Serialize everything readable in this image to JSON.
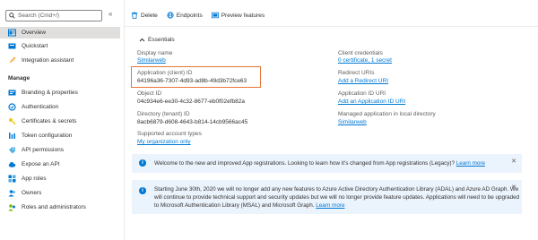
{
  "sidebar": {
    "search_placeholder": "Search (Cmd+/)",
    "collapse_glyph": "«",
    "top_items": [
      {
        "label": "Overview",
        "icon": "overview-icon"
      },
      {
        "label": "Quickstart",
        "icon": "quickstart-icon"
      },
      {
        "label": "Integration assistant",
        "icon": "rocket-icon"
      }
    ],
    "section_manage": "Manage",
    "manage_items": [
      {
        "label": "Branding & properties",
        "icon": "branding-icon"
      },
      {
        "label": "Authentication",
        "icon": "authentication-icon"
      },
      {
        "label": "Certificates & secrets",
        "icon": "key-icon"
      },
      {
        "label": "Token configuration",
        "icon": "token-icon"
      },
      {
        "label": "API permissions",
        "icon": "api-permissions-icon"
      },
      {
        "label": "Expose an API",
        "icon": "cloud-icon"
      },
      {
        "label": "App roles",
        "icon": "app-roles-icon"
      },
      {
        "label": "Owners",
        "icon": "owners-icon"
      },
      {
        "label": "Roles and administrators",
        "icon": "roles-icon"
      }
    ]
  },
  "toolbar": {
    "delete_label": "Delete",
    "endpoints_label": "Endpoints",
    "preview_label": "Preview features"
  },
  "essentials": {
    "title": "Essentials",
    "left": [
      {
        "label": "Display name",
        "value": "Similarweb",
        "link": true
      },
      {
        "label": "Application (client) ID",
        "value": "64196a36-7307-4d93-ad8b-49d3b72fce63",
        "link": false
      },
      {
        "label": "Object ID",
        "value": "04c934e6-ee30-4c32-8677-eb0f02efb82a",
        "link": false
      },
      {
        "label": "Directory (tenant) ID",
        "value": "8acb6879-d608-4643-b814-14cb9566ac45",
        "link": false
      },
      {
        "label": "Supported account types",
        "value": "My organization only",
        "link": true
      }
    ],
    "right": [
      {
        "label": "Client credentials",
        "value": "0 certificate, 1 secret",
        "link": true
      },
      {
        "label": "Redirect URIs",
        "value": "Add a Redirect URI",
        "link": true
      },
      {
        "label": "Application ID URI",
        "value": "Add an Application ID URI",
        "link": true
      },
      {
        "label": "Managed application in local directory",
        "value": "Similarweb",
        "link": true
      }
    ]
  },
  "banners": [
    {
      "text": "Welcome to the new and improved App registrations. Looking to learn how it's changed from App registrations (Legacy)?",
      "link": "Learn more"
    },
    {
      "lines": [
        "Starting June 30th, 2020 we will no longer add any new features to Azure Active Directory Authentication Library (ADAL) and Azure AD Graph. We",
        "will continue to provide technical support and security updates but we will no longer provide feature updates. Applications will need to be upgraded",
        "to Microsoft Authentication Library (MSAL) and Microsoft Graph."
      ],
      "link": "Learn more"
    }
  ],
  "colors": {
    "accent": "#0078d4",
    "highlight_border": "#e97537",
    "banner_bg": "#ebf3fc",
    "active_bg": "#e1dfdd"
  }
}
